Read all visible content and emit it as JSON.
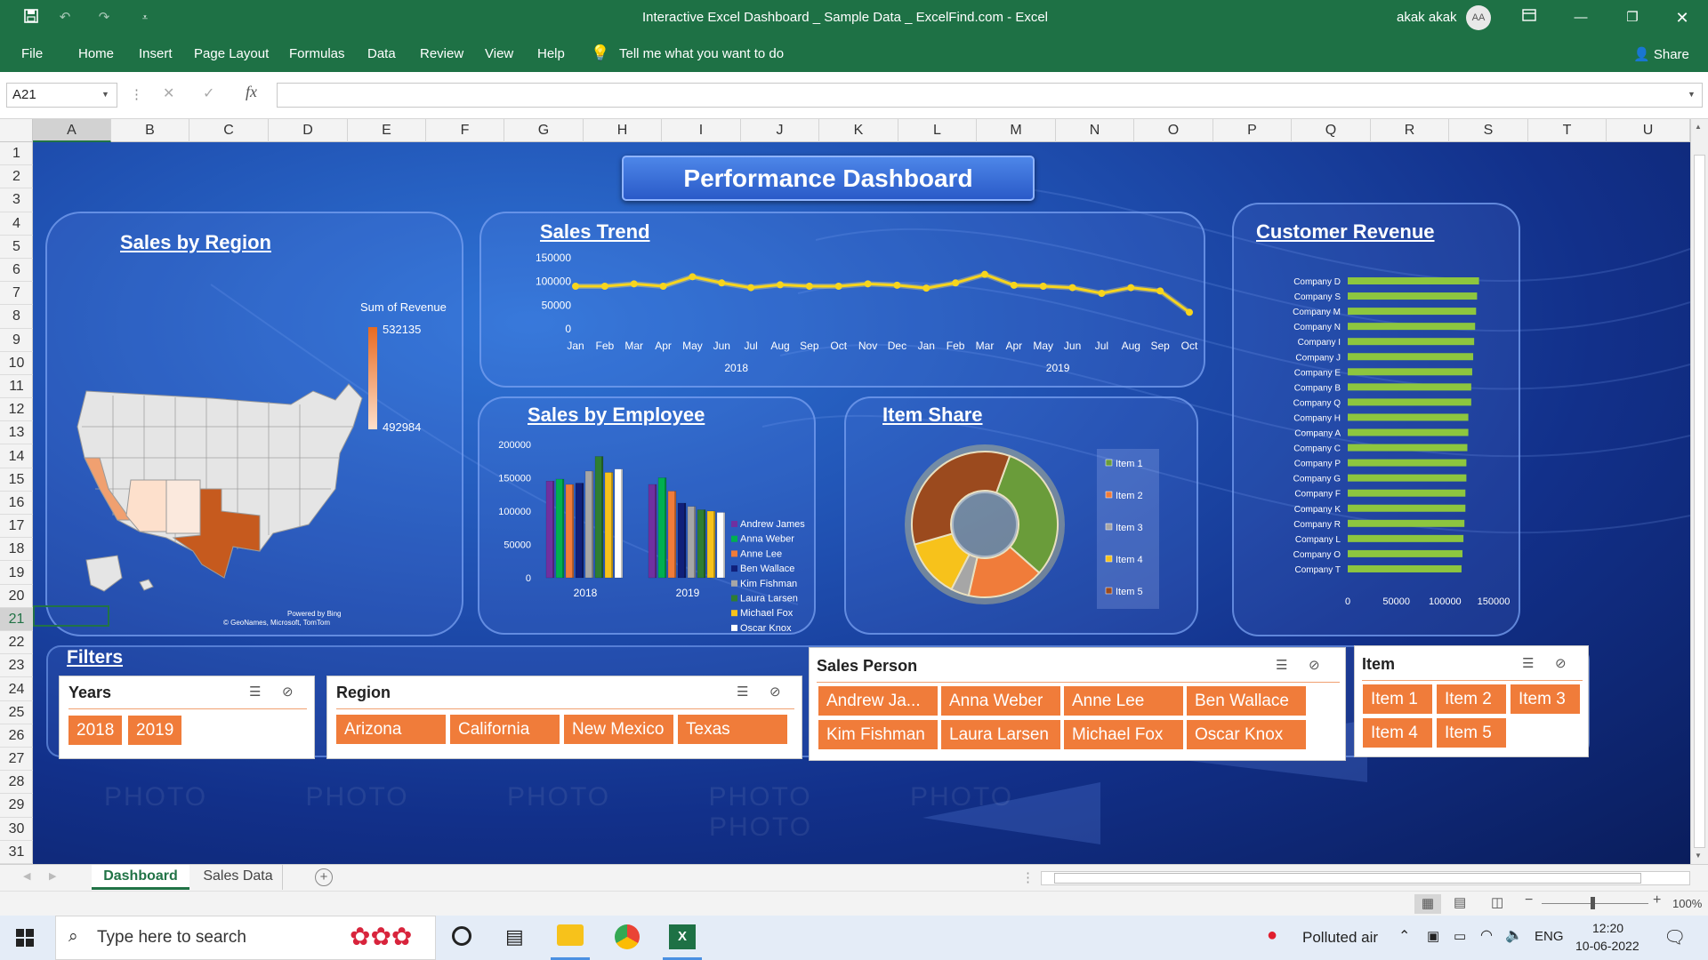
{
  "titlebar": {
    "title": "Interactive Excel Dashboard _ Sample Data _ ExcelFind.com  -  Excel",
    "user": "akak akak",
    "initials": "AA",
    "qat_icons": [
      "save-icon",
      "undo-icon",
      "redo-icon",
      "customize-icon"
    ]
  },
  "ribbon": {
    "tabs": [
      "File",
      "Home",
      "Insert",
      "Page Layout",
      "Formulas",
      "Data",
      "Review",
      "View",
      "Help"
    ],
    "tell_me": "Tell me what you want to do",
    "share": "Share"
  },
  "formula_bar": {
    "name_box": "A21",
    "fx": "fx",
    "formula": ""
  },
  "columns": [
    "A",
    "B",
    "C",
    "D",
    "E",
    "F",
    "G",
    "H",
    "I",
    "J",
    "K",
    "L",
    "M",
    "N",
    "O",
    "P",
    "Q",
    "R",
    "S",
    "T",
    "U"
  ],
  "rows": [
    "1",
    "2",
    "3",
    "4",
    "5",
    "6",
    "7",
    "8",
    "9",
    "10",
    "11",
    "12",
    "13",
    "14",
    "15",
    "16",
    "17",
    "18",
    "19",
    "20",
    "21",
    "22",
    "23",
    "24",
    "25",
    "26",
    "27",
    "28",
    "29",
    "30",
    "31"
  ],
  "dashboard": {
    "title": "Performance Dashboard",
    "watermark": [
      "PHOTO",
      "PHOTO",
      "PHOTO",
      "PHOTO",
      "PHOTO",
      "PHOTO"
    ],
    "region": {
      "title": "Sales by Region",
      "legend_title": "Sum of Revenue",
      "max": "532135",
      "min": "492984",
      "credit1": "Powered by Bing",
      "credit2": "© GeoNames, Microsoft, TomTom"
    },
    "trend": {
      "title": "Sales Trend"
    },
    "employee": {
      "title": "Sales by Employee"
    },
    "item": {
      "title": "Item Share"
    },
    "customer": {
      "title": "Customer Revenue"
    },
    "filters": {
      "title": "Filters",
      "years": {
        "title": "Years",
        "options": [
          "2018",
          "2019"
        ]
      },
      "region": {
        "title": "Region",
        "options": [
          "Arizona",
          "California",
          "New Mexico",
          "Texas"
        ]
      },
      "salesperson": {
        "title": "Sales Person",
        "options": [
          "Andrew Ja...",
          "Anna Weber",
          "Anne Lee",
          "Ben Wallace",
          "Kim Fishman",
          "Laura Larsen",
          "Michael Fox",
          "Oscar Knox"
        ]
      },
      "item": {
        "title": "Item",
        "options": [
          "Item 1",
          "Item 2",
          "Item 3",
          "Item 4",
          "Item 5"
        ]
      }
    }
  },
  "chart_data": [
    {
      "type": "line",
      "title": "Sales Trend",
      "categories": [
        "Jan",
        "Feb",
        "Mar",
        "Apr",
        "May",
        "Jun",
        "Jul",
        "Aug",
        "Sep",
        "Oct",
        "Nov",
        "Dec",
        "Jan",
        "Feb",
        "Mar",
        "Apr",
        "May",
        "Jun",
        "Jul",
        "Aug",
        "Sep",
        "Oct"
      ],
      "groups": [
        {
          "label": "2018",
          "from": 0,
          "to": 11
        },
        {
          "label": "2019",
          "from": 12,
          "to": 21
        }
      ],
      "values": [
        90000,
        90000,
        95000,
        90000,
        110000,
        97000,
        87000,
        93000,
        90000,
        90000,
        95000,
        92000,
        86000,
        97000,
        115000,
        92000,
        90000,
        87000,
        75000,
        87000,
        80000,
        35000
      ],
      "yticks": [
        "150000",
        "100000",
        "50000",
        "0"
      ],
      "ylim": [
        0,
        150000
      ],
      "color": "#f7d51d"
    },
    {
      "type": "bar",
      "title": "Sales by Employee",
      "categories": [
        "2018",
        "2019"
      ],
      "yticks": [
        "200000",
        "150000",
        "100000",
        "50000",
        "0"
      ],
      "ylim": [
        0,
        200000
      ],
      "series": [
        {
          "name": "Andrew James",
          "color": "#7030a0",
          "values": [
            145000,
            140000
          ]
        },
        {
          "name": "Anna Weber",
          "color": "#00b050",
          "values": [
            148000,
            150000
          ]
        },
        {
          "name": "Anne Lee",
          "color": "#f07c3a",
          "values": [
            140000,
            130000
          ]
        },
        {
          "name": "Ben Wallace",
          "color": "#10207a",
          "values": [
            142000,
            112000
          ]
        },
        {
          "name": "Kim Fishman",
          "color": "#a6a6a6",
          "values": [
            160000,
            107000
          ]
        },
        {
          "name": "Laura Larsen",
          "color": "#2e7d32",
          "values": [
            182000,
            102000
          ]
        },
        {
          "name": "Michael Fox",
          "color": "#f7c21b",
          "values": [
            158000,
            100000
          ]
        },
        {
          "name": "Oscar Knox",
          "color": "#ffffff",
          "values": [
            163000,
            98000
          ]
        }
      ]
    },
    {
      "type": "pie",
      "title": "Item Share",
      "series": [
        {
          "name": "Item 1",
          "color": "#6a9c3a",
          "value": 31
        },
        {
          "name": "Item 2",
          "color": "#f07c3a",
          "value": 17
        },
        {
          "name": "Item 3",
          "color": "#a6a6a6",
          "value": 4
        },
        {
          "name": "Item 4",
          "color": "#f7c21b",
          "value": 13
        },
        {
          "name": "Item 5",
          "color": "#9b4a1e",
          "value": 35
        }
      ]
    },
    {
      "type": "bar",
      "orientation": "horizontal",
      "title": "Customer Revenue",
      "categories": [
        "Company D",
        "Company S",
        "Company M",
        "Company N",
        "Company I",
        "Company J",
        "Company E",
        "Company B",
        "Company Q",
        "Company H",
        "Company A",
        "Company C",
        "Company P",
        "Company G",
        "Company F",
        "Company K",
        "Company R",
        "Company L",
        "Company O",
        "Company T"
      ],
      "values": [
        135000,
        133000,
        132000,
        131000,
        130000,
        129000,
        128000,
        127000,
        127000,
        124000,
        124000,
        123000,
        122000,
        122000,
        121000,
        121000,
        120000,
        119000,
        118000,
        117000
      ],
      "xticks": [
        "0",
        "50000",
        "100000",
        "150000"
      ],
      "xlim": [
        0,
        150000
      ],
      "color": "#8dc63f"
    }
  ],
  "sheets": {
    "tabs": [
      "Dashboard",
      "Sales Data"
    ],
    "active": "Dashboard",
    "zoom": "100%"
  },
  "taskbar": {
    "search": "Type here to search",
    "weather": "Polluted air",
    "lang": "ENG",
    "time": "12:20",
    "date": "10-06-2022"
  }
}
